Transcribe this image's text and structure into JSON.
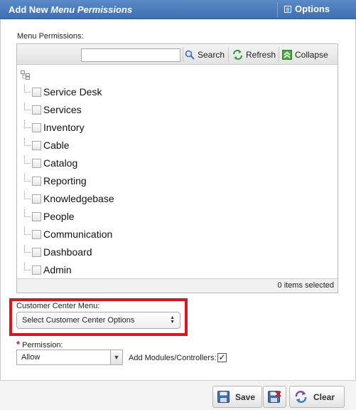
{
  "window": {
    "title_prefix": "Add New",
    "title_emphasis": "Menu Permissions",
    "options_label": "Options"
  },
  "menu_permissions": {
    "label": "Menu Permissions:",
    "search_value": "",
    "search_label": "Search",
    "refresh_label": "Refresh",
    "collapse_label": "Collapse",
    "items": [
      {
        "label": "Service Desk",
        "checked": false
      },
      {
        "label": "Services",
        "checked": false
      },
      {
        "label": "Inventory",
        "checked": false
      },
      {
        "label": "Cable",
        "checked": false
      },
      {
        "label": "Catalog",
        "checked": false
      },
      {
        "label": "Reporting",
        "checked": false
      },
      {
        "label": "Knowledgebase",
        "checked": false
      },
      {
        "label": "People",
        "checked": false
      },
      {
        "label": "Communication",
        "checked": false
      },
      {
        "label": "Dashboard",
        "checked": false
      },
      {
        "label": "Admin",
        "checked": false
      }
    ],
    "status": "0 items selected"
  },
  "customer_center": {
    "label": "Customer Center Menu:",
    "selected": "Select Customer Center Options"
  },
  "permission": {
    "required_mark": "*",
    "label": "Permission:",
    "value": "Allow",
    "add_modules_label": "Add Modules/Controllers:",
    "add_modules_checked": "✓"
  },
  "footer": {
    "save_label": "Save",
    "clear_label": "Clear"
  },
  "colors": {
    "titlebar": "#4a7bbe",
    "highlight": "#d8161b",
    "required": "#d0121b"
  }
}
